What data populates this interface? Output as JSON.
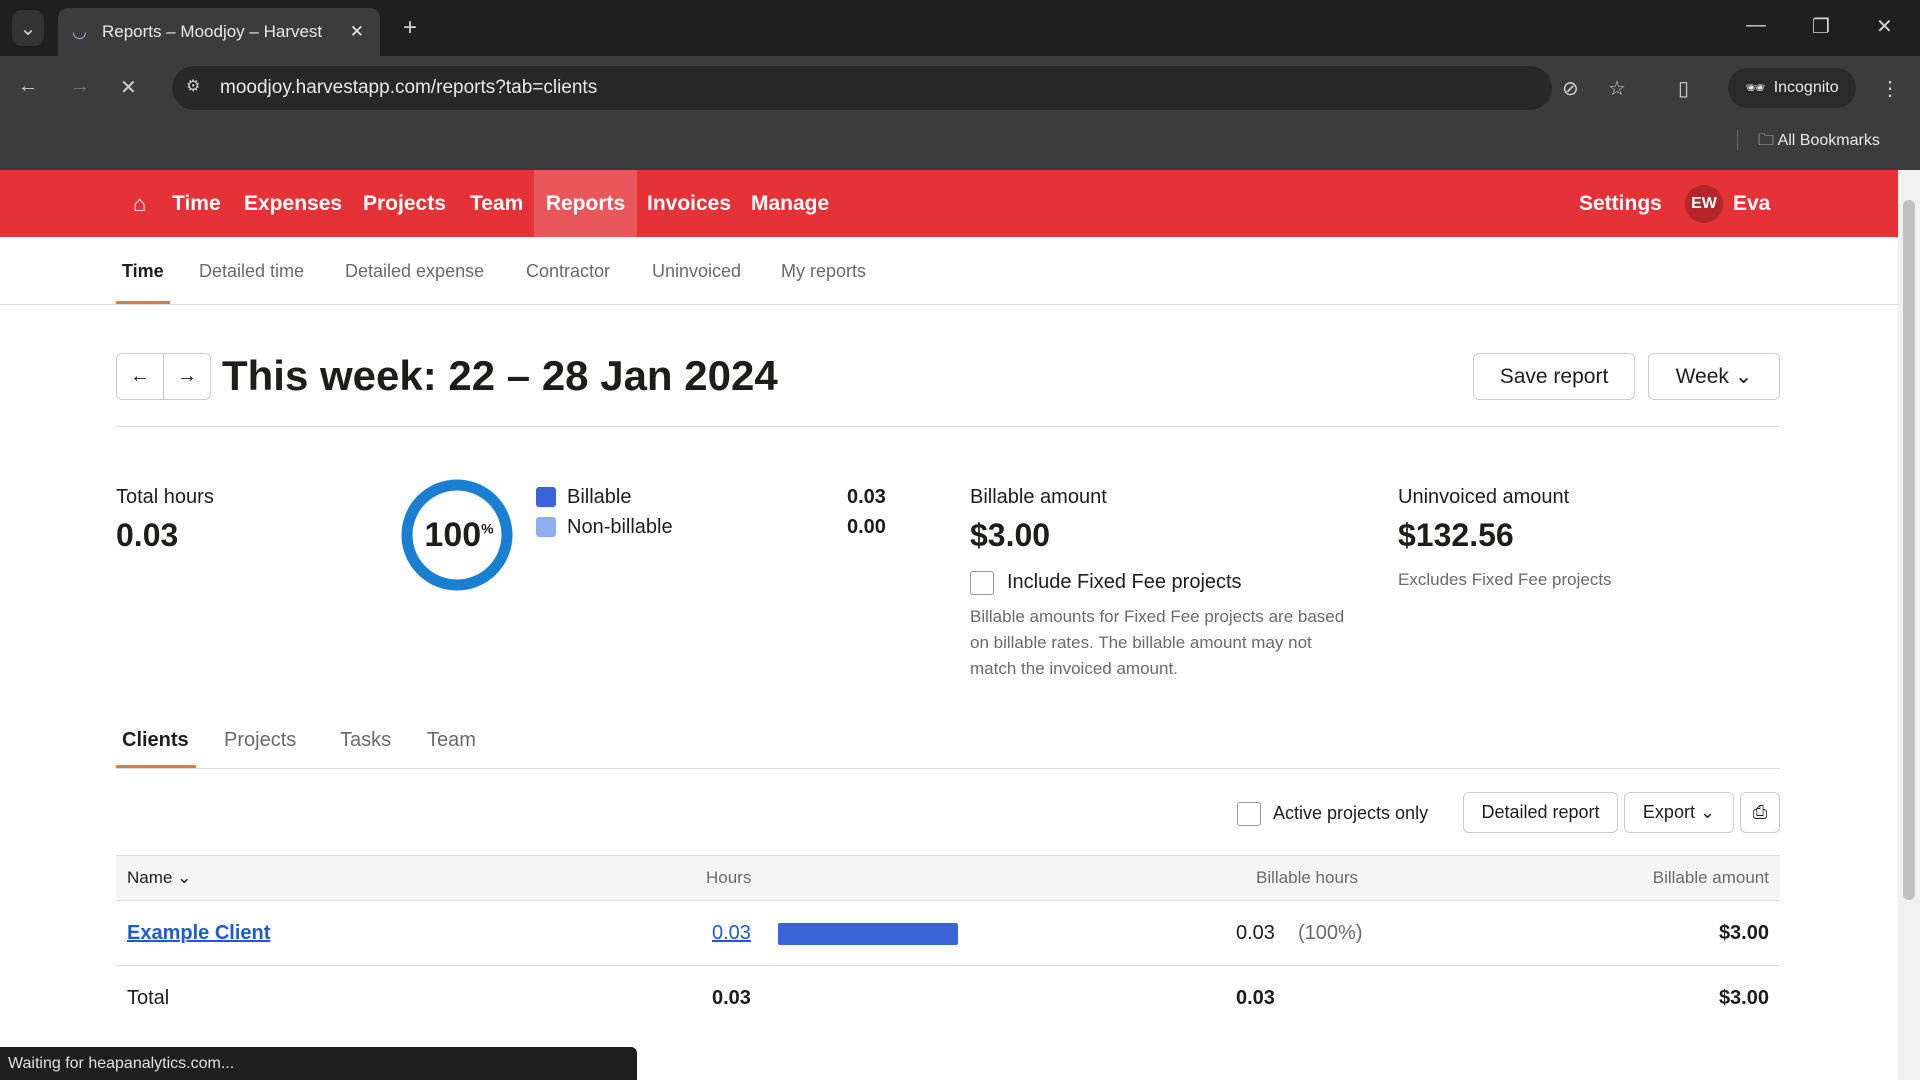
{
  "browser": {
    "tab_title": "Reports – Moodjoy – Harvest",
    "url": "moodjoy.harvestapp.com/reports?tab=clients",
    "profile": "Incognito",
    "bookmarks": "All Bookmarks",
    "status": "Waiting for heapanalytics.com..."
  },
  "nav": {
    "items": [
      "Time",
      "Expenses",
      "Projects",
      "Team",
      "Reports",
      "Invoices",
      "Manage"
    ],
    "active": "Reports",
    "settings": "Settings",
    "avatar_initials": "EW",
    "user": "Eva"
  },
  "subnav": {
    "items": [
      "Time",
      "Detailed time",
      "Detailed expense",
      "Contractor",
      "Uninvoiced",
      "My reports"
    ],
    "active": "Time"
  },
  "header": {
    "title": "This week: 22 – 28 Jan 2024",
    "save": "Save report",
    "period": "Week"
  },
  "summary": {
    "total_hours_label": "Total hours",
    "total_hours": "0.03",
    "donut_percent": "100",
    "donut_unit": "%",
    "billable_fraction": 1.0,
    "legend": [
      {
        "label": "Billable",
        "value": "0.03",
        "color": "#3b63d8"
      },
      {
        "label": "Non-billable",
        "value": "0.00",
        "color": "#8fb0f0"
      }
    ],
    "billable_amount_label": "Billable amount",
    "billable_amount": "$3.00",
    "fixed_fee_label": "Include Fixed Fee projects",
    "fixed_fee_note": "Billable amounts for Fixed Fee projects are based on billable rates. The billable amount may not match the invoiced amount.",
    "uninvoiced_label": "Uninvoiced amount",
    "uninvoiced_amount": "$132.56",
    "uninvoiced_note": "Excludes Fixed Fee projects"
  },
  "tabs": {
    "items": [
      "Clients",
      "Projects",
      "Tasks",
      "Team"
    ],
    "active": "Clients"
  },
  "table_tools": {
    "active_only": "Active projects only",
    "detailed": "Detailed report",
    "export": "Export"
  },
  "table": {
    "headers": [
      "Name",
      "Hours",
      "Billable hours",
      "Billable amount"
    ],
    "rows": [
      {
        "name": "Example Client",
        "hours": "0.03",
        "bar_fraction": 1.0,
        "billable_hours": "0.03",
        "billable_pct": "(100%)",
        "amount": "$3.00"
      }
    ],
    "total": {
      "label": "Total",
      "hours": "0.03",
      "billable_hours": "0.03",
      "amount": "$3.00"
    }
  }
}
